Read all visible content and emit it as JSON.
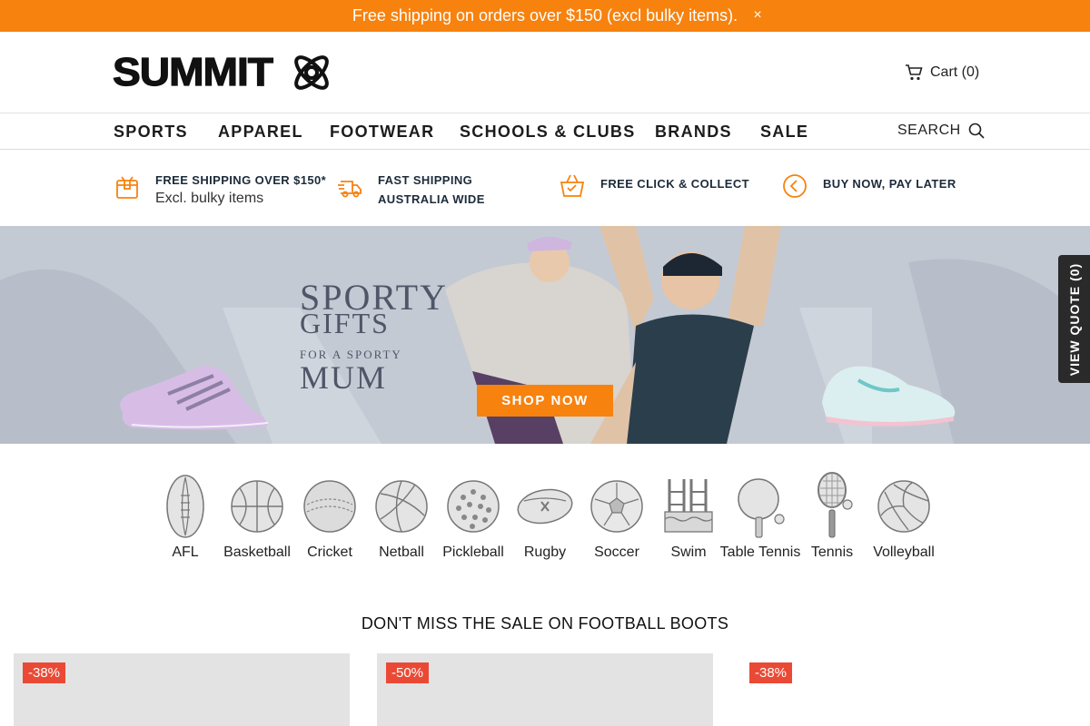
{
  "announcement": {
    "text": "Free shipping on orders over $150 (excl bulky items).",
    "close": "×"
  },
  "header": {
    "logo_text": "SUMMIT",
    "cart_label": "Cart (0)"
  },
  "nav": {
    "items": [
      "SPORTS",
      "APPAREL",
      "FOOTWEAR",
      "SCHOOLS & CLUBS",
      "BRANDS",
      "SALE"
    ],
    "search_label": "SEARCH"
  },
  "usps": [
    {
      "title": "FREE SHIPPING OVER $150*",
      "sub": "Excl. bulky items",
      "icon": "box-icon"
    },
    {
      "title": "FAST SHIPPING",
      "title2": "AUSTRALIA WIDE",
      "icon": "truck-icon"
    },
    {
      "title": "FREE CLICK & COLLECT",
      "icon": "basket-icon"
    },
    {
      "title": "BUY NOW, PAY LATER",
      "icon": "chevron-circle-icon"
    }
  ],
  "hero": {
    "line1": "SPORTY",
    "line2": "GIFTS",
    "line3": "FOR A SPORTY",
    "line4": "MUM",
    "cta": "SHOP NOW"
  },
  "quote_tab": "VIEW QUOTE (0)",
  "sports": [
    {
      "label": "AFL",
      "icon": "afl-ball-icon"
    },
    {
      "label": "Basketball",
      "icon": "basketball-icon"
    },
    {
      "label": "Cricket",
      "icon": "cricket-ball-icon"
    },
    {
      "label": "Netball",
      "icon": "netball-icon"
    },
    {
      "label": "Pickleball",
      "icon": "pickleball-icon"
    },
    {
      "label": "Rugby",
      "icon": "rugby-ball-icon"
    },
    {
      "label": "Soccer",
      "icon": "soccer-ball-icon"
    },
    {
      "label": "Swim",
      "icon": "swim-icon"
    },
    {
      "label": "Table Tennis",
      "icon": "table-tennis-icon"
    },
    {
      "label": "Tennis",
      "icon": "tennis-racket-icon"
    },
    {
      "label": "Volleyball",
      "icon": "volleyball-icon"
    }
  ],
  "section_title": "DON'T MISS THE SALE ON FOOTBALL BOOTS",
  "products": [
    {
      "discount": "-38%"
    },
    {
      "discount": "-50%"
    },
    {
      "discount": "-38%"
    }
  ],
  "colors": {
    "brand_orange": "#f7820e",
    "sale_red": "#ea4a35",
    "hero_bg": "#c4cad4"
  }
}
